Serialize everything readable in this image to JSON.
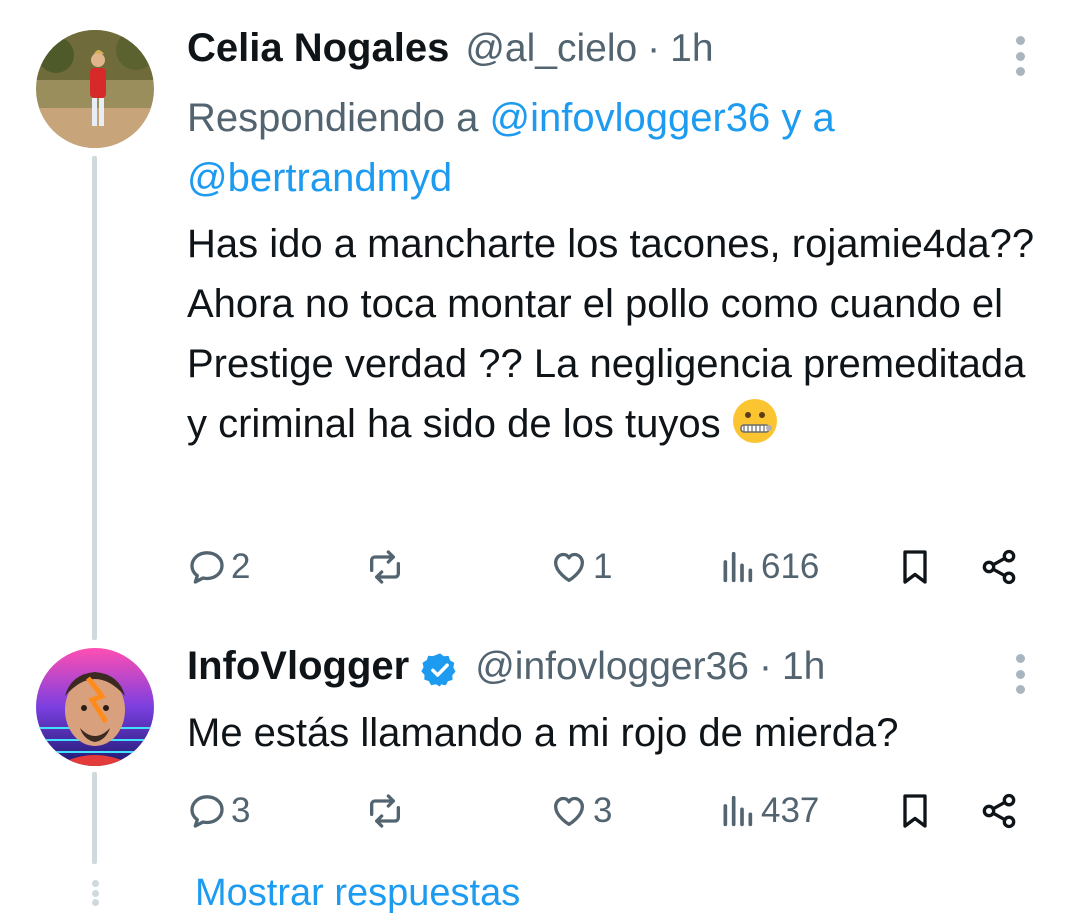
{
  "tweets": [
    {
      "name": "Celia Nogales",
      "handle": "@al_cielo",
      "dot": "·",
      "time": "1h",
      "verified": false,
      "replying_prefix": "Respondiendo a",
      "replying_handle1": "@infovlogger36",
      "replying_conj": "y a",
      "replying_handle2": "@bertrandmyd",
      "text": "Has ido a mancharte los tacones, rojamie4da?? Ahora no toca montar el pollo como cuando el Prestige verdad ?? La negligencia premeditada y criminal ha sido de los tuyos",
      "emoji": "zipper-mouth-face",
      "replies": "2",
      "retweets": "",
      "likes": "1",
      "views": "616"
    },
    {
      "name": "InfoVlogger",
      "handle": "@infovlogger36",
      "dot": "·",
      "time": "1h",
      "verified": true,
      "text": "Me estás llamando a mi rojo de mierda?",
      "replies": "3",
      "retweets": "",
      "likes": "3",
      "views": "437"
    }
  ],
  "show_more_label": "Mostrar respuestas",
  "colors": {
    "text": "#0f1419",
    "secondary": "#536471",
    "accent": "#1d9bf0",
    "thread_line": "#cfd9de"
  },
  "icons": [
    "reply-icon",
    "retweet-icon",
    "like-icon",
    "views-icon",
    "bookmark-icon",
    "share-icon",
    "more-icon",
    "verified-badge-icon"
  ]
}
